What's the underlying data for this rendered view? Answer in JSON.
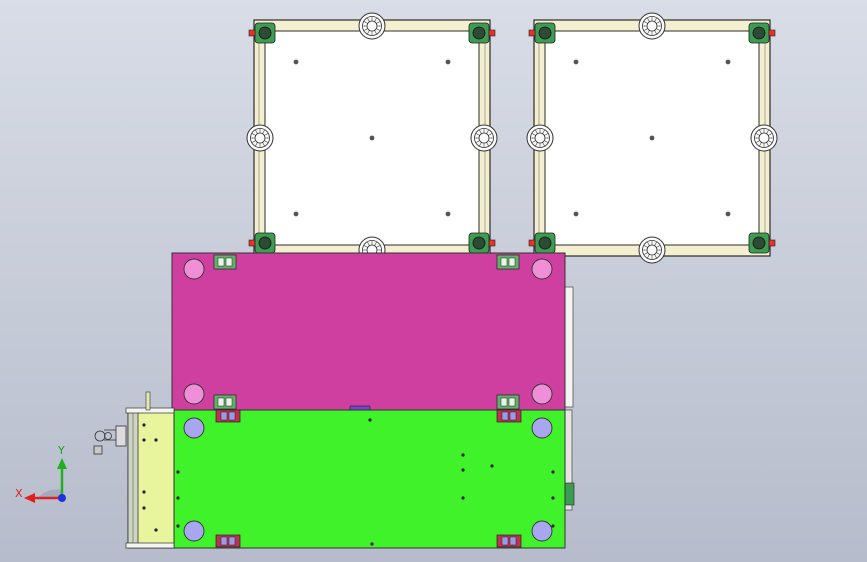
{
  "viewport": {
    "background_top": "#d8dde6",
    "background_bottom": "#b6bccb"
  },
  "colors": {
    "frame_fill": "#f3efcf",
    "frame_stroke": "#2b2b2b",
    "panel_fill": "#ffffff",
    "magenta_plate": "#cf3f9f",
    "green_plate": "#3ff22a",
    "light_yellow_block": "#e9f59c",
    "pink_pad": "#ef8fd8",
    "lavender_pad": "#a8a6ee",
    "caster_green": "#3c9c52",
    "caster_red": "#e8302a",
    "clamp_green": "#62b06a",
    "axis_x": "#e02020",
    "axis_y": "#20b020",
    "axis_z": "#2030e0"
  },
  "triad": {
    "x_label": "X",
    "y_label": "Y",
    "x_icon": "axis-x-arrow-icon",
    "y_icon": "axis-y-arrow-icon",
    "z_icon": "axis-z-origin-icon"
  },
  "parts": {
    "left_pallet": "fixture-pallet-left",
    "right_pallet": "fixture-pallet-right",
    "magenta_plate": "mold-plate-upper",
    "green_plate": "mold-plate-lower",
    "side_block": "side-guide-block"
  }
}
